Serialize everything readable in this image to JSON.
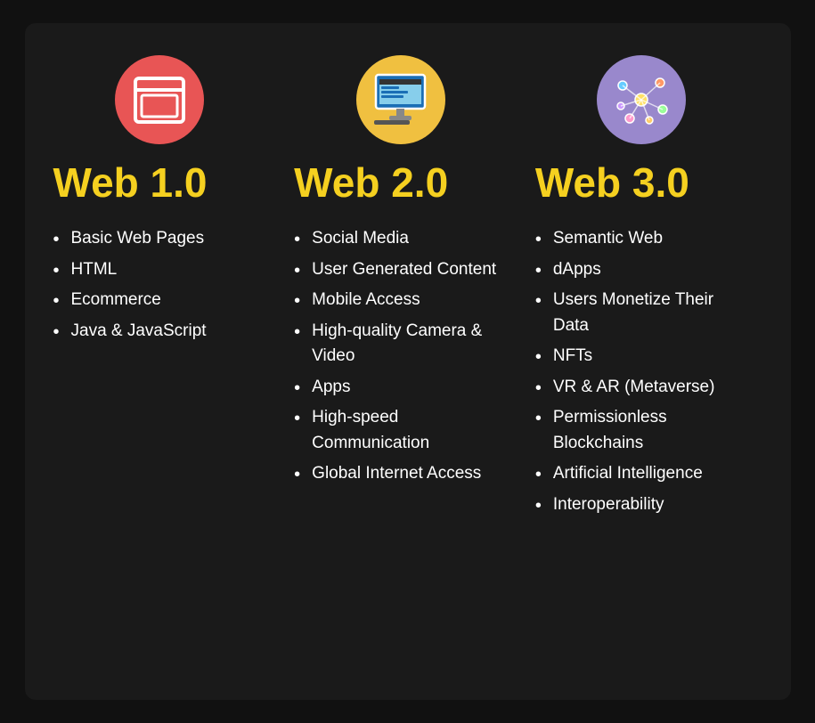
{
  "columns": [
    {
      "id": "web1",
      "icon_type": "browser",
      "icon_bg": "red",
      "title": "Web 1.0",
      "features": [
        "Basic Web Pages",
        "HTML",
        "Ecommerce",
        "Java & JavaScript"
      ]
    },
    {
      "id": "web2",
      "icon_type": "computer",
      "icon_bg": "yellow",
      "title": "Web 2.0",
      "features": [
        "Social Media",
        "User Generated Content",
        "Mobile Access",
        "High-quality Camera & Video",
        "Apps",
        "High-speed Communication",
        "Global Internet Access"
      ]
    },
    {
      "id": "web3",
      "icon_type": "network",
      "icon_bg": "purple",
      "title": "Web 3.0",
      "features": [
        "Semantic Web",
        "dApps",
        "Users Monetize Their Data",
        "NFTs",
        "VR & AR (Metaverse)",
        "Permissionless Blockchains",
        "Artificial Intelligence",
        "Interoperability"
      ]
    }
  ]
}
